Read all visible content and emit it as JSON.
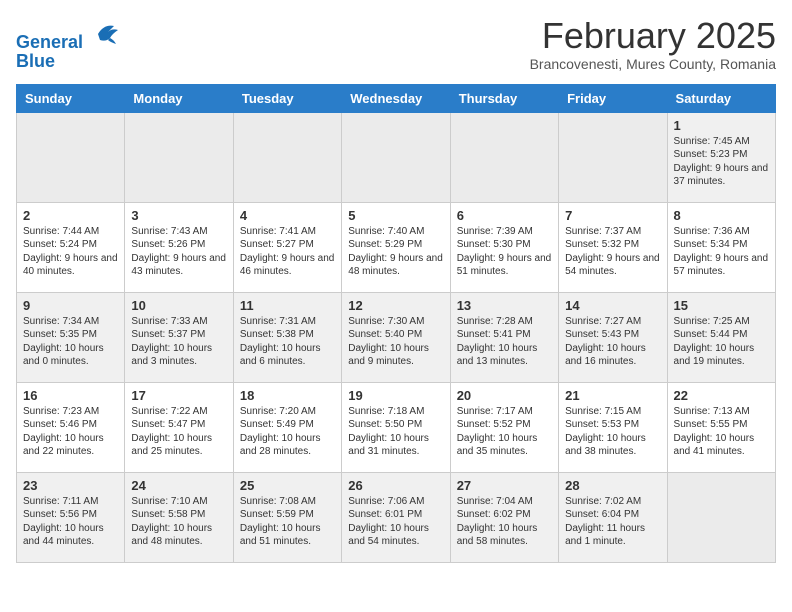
{
  "header": {
    "logo_line1": "General",
    "logo_line2": "Blue",
    "month_title": "February 2025",
    "subtitle": "Brancovenesti, Mures County, Romania"
  },
  "weekdays": [
    "Sunday",
    "Monday",
    "Tuesday",
    "Wednesday",
    "Thursday",
    "Friday",
    "Saturday"
  ],
  "weeks": [
    [
      {
        "day": "",
        "info": ""
      },
      {
        "day": "",
        "info": ""
      },
      {
        "day": "",
        "info": ""
      },
      {
        "day": "",
        "info": ""
      },
      {
        "day": "",
        "info": ""
      },
      {
        "day": "",
        "info": ""
      },
      {
        "day": "1",
        "info": "Sunrise: 7:45 AM\nSunset: 5:23 PM\nDaylight: 9 hours and 37 minutes."
      }
    ],
    [
      {
        "day": "2",
        "info": "Sunrise: 7:44 AM\nSunset: 5:24 PM\nDaylight: 9 hours and 40 minutes."
      },
      {
        "day": "3",
        "info": "Sunrise: 7:43 AM\nSunset: 5:26 PM\nDaylight: 9 hours and 43 minutes."
      },
      {
        "day": "4",
        "info": "Sunrise: 7:41 AM\nSunset: 5:27 PM\nDaylight: 9 hours and 46 minutes."
      },
      {
        "day": "5",
        "info": "Sunrise: 7:40 AM\nSunset: 5:29 PM\nDaylight: 9 hours and 48 minutes."
      },
      {
        "day": "6",
        "info": "Sunrise: 7:39 AM\nSunset: 5:30 PM\nDaylight: 9 hours and 51 minutes."
      },
      {
        "day": "7",
        "info": "Sunrise: 7:37 AM\nSunset: 5:32 PM\nDaylight: 9 hours and 54 minutes."
      },
      {
        "day": "8",
        "info": "Sunrise: 7:36 AM\nSunset: 5:34 PM\nDaylight: 9 hours and 57 minutes."
      }
    ],
    [
      {
        "day": "9",
        "info": "Sunrise: 7:34 AM\nSunset: 5:35 PM\nDaylight: 10 hours and 0 minutes."
      },
      {
        "day": "10",
        "info": "Sunrise: 7:33 AM\nSunset: 5:37 PM\nDaylight: 10 hours and 3 minutes."
      },
      {
        "day": "11",
        "info": "Sunrise: 7:31 AM\nSunset: 5:38 PM\nDaylight: 10 hours and 6 minutes."
      },
      {
        "day": "12",
        "info": "Sunrise: 7:30 AM\nSunset: 5:40 PM\nDaylight: 10 hours and 9 minutes."
      },
      {
        "day": "13",
        "info": "Sunrise: 7:28 AM\nSunset: 5:41 PM\nDaylight: 10 hours and 13 minutes."
      },
      {
        "day": "14",
        "info": "Sunrise: 7:27 AM\nSunset: 5:43 PM\nDaylight: 10 hours and 16 minutes."
      },
      {
        "day": "15",
        "info": "Sunrise: 7:25 AM\nSunset: 5:44 PM\nDaylight: 10 hours and 19 minutes."
      }
    ],
    [
      {
        "day": "16",
        "info": "Sunrise: 7:23 AM\nSunset: 5:46 PM\nDaylight: 10 hours and 22 minutes."
      },
      {
        "day": "17",
        "info": "Sunrise: 7:22 AM\nSunset: 5:47 PM\nDaylight: 10 hours and 25 minutes."
      },
      {
        "day": "18",
        "info": "Sunrise: 7:20 AM\nSunset: 5:49 PM\nDaylight: 10 hours and 28 minutes."
      },
      {
        "day": "19",
        "info": "Sunrise: 7:18 AM\nSunset: 5:50 PM\nDaylight: 10 hours and 31 minutes."
      },
      {
        "day": "20",
        "info": "Sunrise: 7:17 AM\nSunset: 5:52 PM\nDaylight: 10 hours and 35 minutes."
      },
      {
        "day": "21",
        "info": "Sunrise: 7:15 AM\nSunset: 5:53 PM\nDaylight: 10 hours and 38 minutes."
      },
      {
        "day": "22",
        "info": "Sunrise: 7:13 AM\nSunset: 5:55 PM\nDaylight: 10 hours and 41 minutes."
      }
    ],
    [
      {
        "day": "23",
        "info": "Sunrise: 7:11 AM\nSunset: 5:56 PM\nDaylight: 10 hours and 44 minutes."
      },
      {
        "day": "24",
        "info": "Sunrise: 7:10 AM\nSunset: 5:58 PM\nDaylight: 10 hours and 48 minutes."
      },
      {
        "day": "25",
        "info": "Sunrise: 7:08 AM\nSunset: 5:59 PM\nDaylight: 10 hours and 51 minutes."
      },
      {
        "day": "26",
        "info": "Sunrise: 7:06 AM\nSunset: 6:01 PM\nDaylight: 10 hours and 54 minutes."
      },
      {
        "day": "27",
        "info": "Sunrise: 7:04 AM\nSunset: 6:02 PM\nDaylight: 10 hours and 58 minutes."
      },
      {
        "day": "28",
        "info": "Sunrise: 7:02 AM\nSunset: 6:04 PM\nDaylight: 11 hours and 1 minute."
      },
      {
        "day": "",
        "info": ""
      }
    ]
  ]
}
